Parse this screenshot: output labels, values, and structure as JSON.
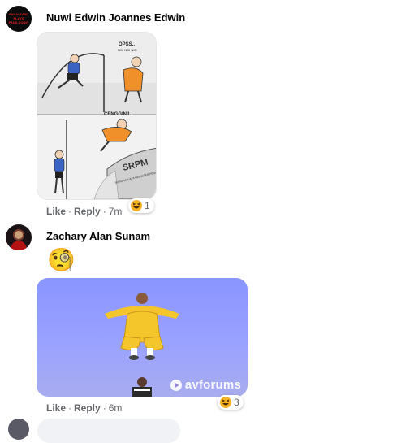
{
  "comments": [
    {
      "author": "Nuwi Edwin Joannes Edwin",
      "avatar_text": "PANASONIC PLAYS PANA SONIC",
      "comic_text_1": "OPSS..",
      "comic_text_2": "NGI NGI NGI",
      "comic_text_3": "CENGGINI!..",
      "comic_text_4": "SRPM",
      "comic_text_5": "SURUHANJAYA REGISTER PENGURUSAN MALAYSIA",
      "like_label": "Like",
      "reply_label": "Reply",
      "time": "7m",
      "reaction_count": "1"
    },
    {
      "author": "Zachary Alan Sunam",
      "emoji": "🧐",
      "watermark": "avforums",
      "like_label": "Like",
      "reply_label": "Reply",
      "time": "6m",
      "reaction_count": "3"
    }
  ],
  "colors": {
    "name": "#050505",
    "meta": "#65676b",
    "bubble": "#f0f2f5",
    "sky": "#8f9bff",
    "robe": "#f4c62b"
  }
}
